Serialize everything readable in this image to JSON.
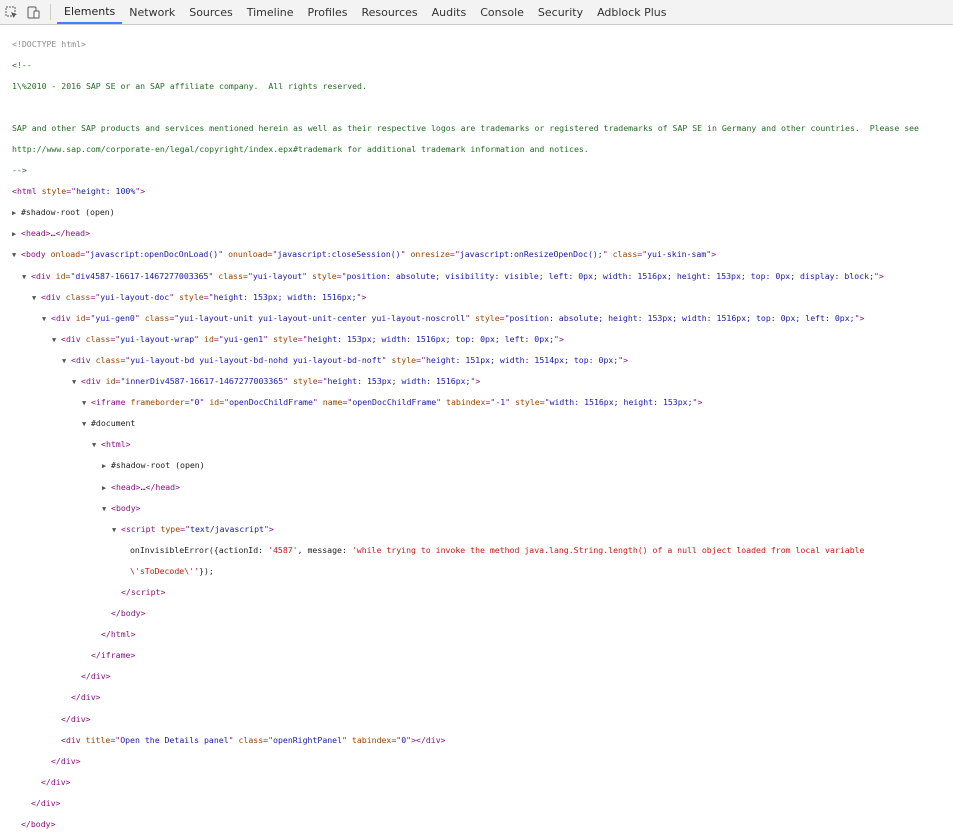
{
  "toolbar": {
    "inspect_icon": "inspect-element-icon",
    "device_icon": "device-mode-icon",
    "tabs": [
      "Elements",
      "Network",
      "Sources",
      "Timeline",
      "Profiles",
      "Resources",
      "Audits",
      "Console",
      "Security",
      "Adblock Plus"
    ],
    "active_tab": "Elements",
    "accent_color": "#3e82f7"
  },
  "lines": {
    "l1": "<!DOCTYPE html>",
    "l2": "<!--",
    "l3": "1\\%2010 - 2016 SAP SE or an SAP affiliate company.  All rights reserved.",
    "l4": "",
    "l5": "SAP and other SAP products and services mentioned herein as well as their respective logos are trademarks or registered trademarks of SAP SE in Germany and other countries.  Please see",
    "l6": "http://www.sap.com/corporate-en/legal/copyright/index.epx#trademark for additional trademark information and notices.",
    "l7": "-->",
    "html_tag": "html",
    "html_style_attr": "style",
    "html_style_val": "height: 100%",
    "shadow_root": "#shadow-root (open)",
    "head_tag": "head",
    "ellipsis": "…",
    "body_tag": "body",
    "body_onload_attr": "onload",
    "body_onload_val": "javascript:openDocOnLoad()",
    "body_onunload_attr": "onunload",
    "body_onunload_val": "javascript:closeSession()",
    "body_onresize_attr": "onresize",
    "body_onresize_val": "javascript:onResizeOpenDoc();",
    "class_attr": "class",
    "body_class_val": "yui-skin-sam",
    "div_tag": "div",
    "id_attr": "id",
    "style_attr": "style",
    "div1_id": "div4587-16617-1467277003365",
    "div1_class": "yui-layout",
    "div1_style": "position: absolute; visibility: visible; left: 0px; width: 1516px; height: 153px; top: 0px; display: block;",
    "div2_class": "yui-layout-doc",
    "div2_style": "height: 153px; width: 1516px;",
    "div3_id": "yui-gen0",
    "div3_class": "yui-layout-unit yui-layout-unit-center yui-layout-noscroll",
    "div3_style": "position: absolute; height: 153px; width: 1516px; top: 0px; left: 0px;",
    "div4_class": "yui-layout-wrap",
    "div4_id": "yui-gen1",
    "div4_style": "height: 153px; width: 1516px; top: 0px; left: 0px;",
    "div5_class": "yui-layout-bd yui-layout-bd-nohd yui-layout-bd-noft",
    "div5_style": "height: 151px; width: 1514px; top: 0px;",
    "div6_id": "innerDiv4587-16617-1467277003365",
    "div6_style": "height: 153px; width: 1516px;",
    "iframe_tag": "iframe",
    "frameborder_attr": "frameborder",
    "frameborder_val": "0",
    "iframe_id": "openDocChildFrame",
    "name_attr": "name",
    "iframe_name": "openDocChildFrame",
    "tabindex_attr": "tabindex",
    "iframe_tabindex": "-1",
    "iframe_style": "width: 1516px; height: 153px;",
    "document": "#document",
    "script_tag": "script",
    "type_attr": "type",
    "script_type": "text/javascript",
    "js_prefix": "onInvisibleError({actionId: ",
    "js_action_id": "'4587'",
    "js_mid": ", message: ",
    "js_message": "'while trying to invoke the method java.lang.String.length() of a null object loaded from local variable",
    "js_message_cont": "\\'sToDecode\\''",
    "js_suffix": "});",
    "div7_title_attr": "title",
    "div7_title": "Open the Details panel",
    "div7_class": "openRightPanel",
    "div7_tabindex": "0"
  }
}
